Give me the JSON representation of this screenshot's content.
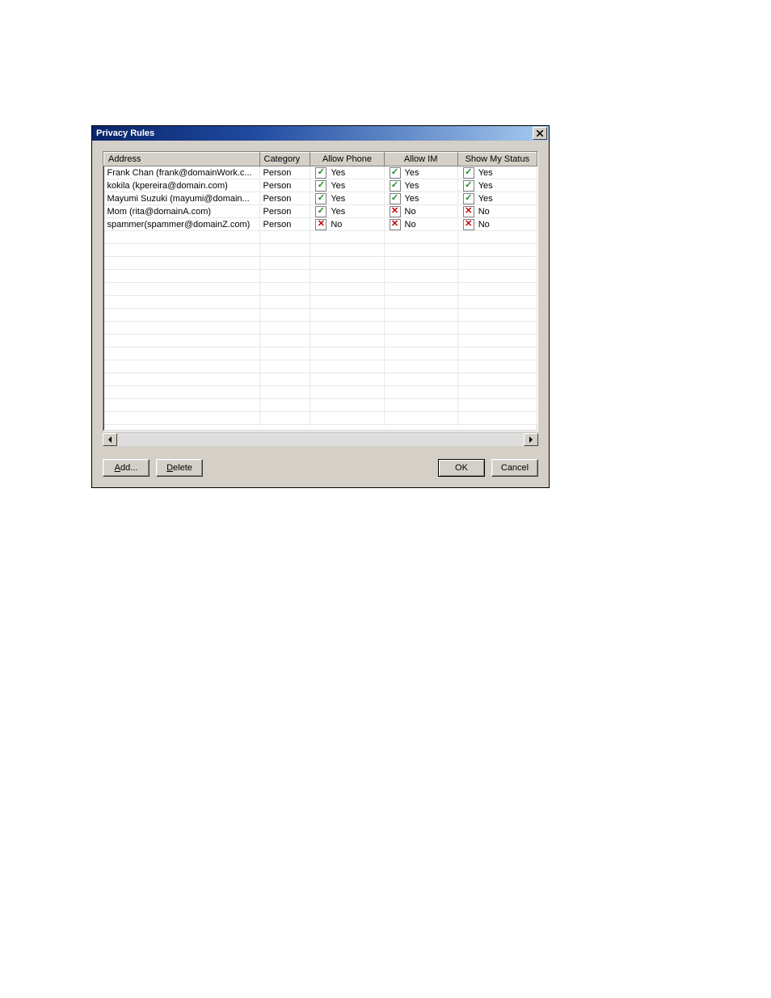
{
  "window": {
    "title": "Privacy Rules"
  },
  "list": {
    "headers": {
      "address": "Address",
      "category": "Category",
      "phone": "Allow Phone",
      "im": "Allow IM",
      "status": "Show My Status"
    },
    "yes_label": "Yes",
    "no_label": "No",
    "rows": [
      {
        "address": "Frank Chan (frank@domainWork.c...",
        "category": "Person",
        "phone": true,
        "im": true,
        "status": true
      },
      {
        "address": "kokila (kpereira@domain.com)",
        "category": "Person",
        "phone": true,
        "im": true,
        "status": true
      },
      {
        "address": "Mayumi Suzuki (mayumi@domain...",
        "category": "Person",
        "phone": true,
        "im": true,
        "status": true
      },
      {
        "address": "Mom (rita@domainA.com)",
        "category": "Person",
        "phone": true,
        "im": false,
        "status": false
      },
      {
        "address": "spammer(spammer@domainZ.com)",
        "category": "Person",
        "phone": false,
        "im": false,
        "status": false
      }
    ],
    "empty_row_count": 15
  },
  "buttons": {
    "add": {
      "full": "Add...",
      "pre": "",
      "mnemonic": "A",
      "post": "dd..."
    },
    "delete": {
      "full": "Delete",
      "pre": "",
      "mnemonic": "D",
      "post": "elete"
    },
    "ok": "OK",
    "cancel": "Cancel"
  }
}
